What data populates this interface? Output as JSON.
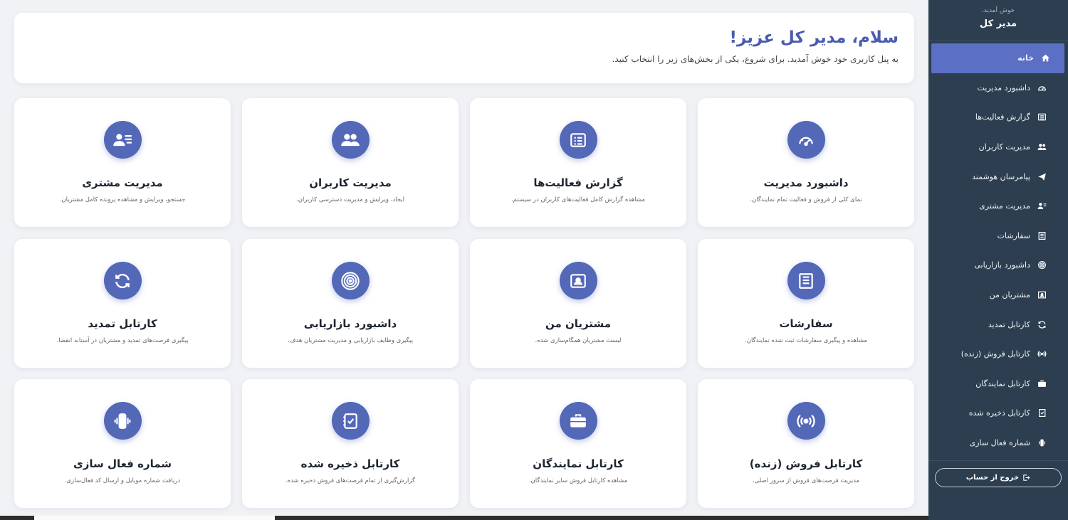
{
  "sidebar": {
    "welcome": "خوش آمدید،",
    "user": "مدیر کل",
    "items": [
      {
        "label": "خانه",
        "icon": "home-icon"
      },
      {
        "label": "داشبورد مدیریت",
        "icon": "gauge-icon"
      },
      {
        "label": "گزارش فعالیت‌ها",
        "icon": "list-icon"
      },
      {
        "label": "مدیریت کاربران",
        "icon": "users-icon"
      },
      {
        "label": "پیامرسان هوشمند",
        "icon": "send-icon"
      },
      {
        "label": "مدیریت مشتری",
        "icon": "contact-icon"
      },
      {
        "label": "سفارشات",
        "icon": "receipt-icon"
      },
      {
        "label": "داشبورد بازاریابی",
        "icon": "target-icon"
      },
      {
        "label": "مشتریان من",
        "icon": "id-card-icon"
      },
      {
        "label": "کارتابل تمدید",
        "icon": "refresh-icon"
      },
      {
        "label": "کارتابل فروش (زنده)",
        "icon": "broadcast-icon"
      },
      {
        "label": "کارتابل نمایندگان",
        "icon": "briefcase-icon"
      },
      {
        "label": "کارتابل ذخیره شده",
        "icon": "saved-icon"
      },
      {
        "label": "شماره فعال سازی",
        "icon": "phone-icon"
      }
    ],
    "logout": "خروج از حساب"
  },
  "welcome": {
    "title": "سلام، مدیر کل عزیز!",
    "subtitle": "به پنل کاربری خود خوش آمدید. برای شروع، یکی از بخش‌های زیر را انتخاب کنید."
  },
  "cards": [
    {
      "title": "داشبورد مدیریت",
      "desc": "نمای کلی از فروش و فعالیت تمام نمایندگان.",
      "icon": "gauge-icon"
    },
    {
      "title": "گزارش فعالیت‌ها",
      "desc": "مشاهده گزارش کامل فعالیت‌های کاربران در سیستم.",
      "icon": "list-icon"
    },
    {
      "title": "مدیریت کاربران",
      "desc": "ایجاد، ویرایش و مدیریت دسترسی کاربران.",
      "icon": "users-icon"
    },
    {
      "title": "مدیریت مشتری",
      "desc": "جستجو، ویرایش و مشاهده پرونده کامل مشتریان.",
      "icon": "contact-icon"
    },
    {
      "title": "سفارشات",
      "desc": "مشاهده و پیگیری سفارشات ثبت شده نمایندگان.",
      "icon": "receipt-icon"
    },
    {
      "title": "مشتریان من",
      "desc": "لیست مشتریان همگام‌سازی شده.",
      "icon": "id-card-icon"
    },
    {
      "title": "داشبورد بازاریابی",
      "desc": "پیگیری وظایف بازاریابی و مدیریت مشتریان هدف.",
      "icon": "target-icon"
    },
    {
      "title": "کارتابل تمدید",
      "desc": "پیگیری فرصت‌های تمدید و مشتریان در آستانه انقضا.",
      "icon": "refresh-icon"
    },
    {
      "title": "کارتابل فروش (زنده)",
      "desc": "مدیریت فرصت‌های فروش از سرور اصلی.",
      "icon": "broadcast-icon"
    },
    {
      "title": "کارتابل نمایندگان",
      "desc": "مشاهده کارتابل فروش سایر نمایندگان.",
      "icon": "briefcase-icon"
    },
    {
      "title": "کارتابل ذخیره شده",
      "desc": "گزارش‌گیری از تمام فرصت‌های فروش ذخیره شده.",
      "icon": "saved-icon"
    },
    {
      "title": "شماره فعال سازی",
      "desc": "دریافت شماره موبایل و ارسال کد فعال‌سازی.",
      "icon": "phone-icon"
    }
  ],
  "colors": {
    "sidebar_bg": "#2c3e50",
    "accent": "#5468b8",
    "active_item": "#5b6fc4",
    "title": "#4a5bb0"
  }
}
